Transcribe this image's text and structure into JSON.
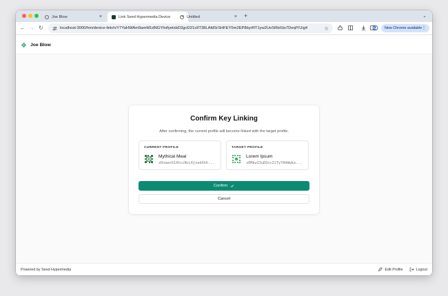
{
  "browser": {
    "tabs": [
      {
        "title": "Joe Blow",
        "active": false
      },
      {
        "title": "Link Seed Hypermedia Device",
        "active": true
      },
      {
        "title": "Untitled",
        "active": false
      }
    ],
    "new_tab_label": "+",
    "url": "localhost:3000/hm/device-link#zY7YaHWAm9amM1dNGYfoifyetxbD2goD21s9T38LAfdSrSHFEY5m2EP8byrRT1yw2UoSRbiSis7DeqfYUig4",
    "new_chrome_label": "New Chrome available"
  },
  "site": {
    "name": "Joe Blow",
    "logo_icon": "seed-logo-icon"
  },
  "dialog": {
    "title": "Confirm Key Linking",
    "description": "After confirming, the current profile will become linked with the target profile.",
    "current": {
      "label": "CURRENT PROFILE",
      "name": "Mythical Meal",
      "key": "zDnaeoS1XhccNcL6joakXhV..."
    },
    "target": {
      "label": "TARGET PROFILE",
      "name": "Lorem Ipsum",
      "key": "z6Mkw13uEQxcZiTy7AhWwka..."
    },
    "confirm_label": "Confirm",
    "cancel_label": "Cancel"
  },
  "footer": {
    "powered_by": "Powered by Seed Hypermedia",
    "edit_profile": "Edit Profile",
    "logout": "Logout"
  },
  "colors": {
    "accent": "#0c8b73",
    "avatar_current": "#2b7a4b",
    "avatar_target": "#4caf6e"
  }
}
